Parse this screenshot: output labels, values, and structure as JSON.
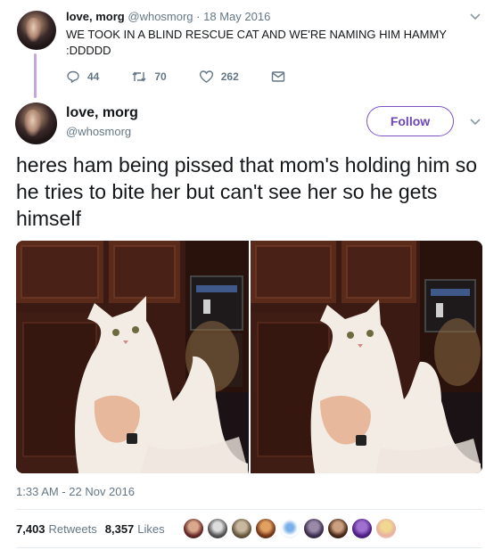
{
  "quoted_tweet": {
    "display_name": "love, morg",
    "handle": "@whosmorg",
    "separator": "·",
    "date": "18 May 2016",
    "text": "WE TOOK IN A BLIND RESCUE CAT AND WE'RE NAMING HIM HAMMY :DDDDD",
    "replies": "44",
    "retweets": "70",
    "likes": "262"
  },
  "tweet": {
    "display_name": "love, morg",
    "handle": "@whosmorg",
    "follow_label": "Follow",
    "text": "heres ham being pissed that mom's holding him so he tries to bite her but can't see her so he gets himself",
    "timestamp": "1:33 AM - 22 Nov 2016",
    "retweets_count": "7,403",
    "retweets_label": "Retweets",
    "likes_count": "8,357",
    "likes_label": "Likes"
  },
  "icons": {
    "reply": "reply-icon",
    "retweet": "retweet-icon",
    "like": "heart-icon",
    "dm": "envelope-icon",
    "caret": "chevron-down-icon"
  },
  "colors": {
    "follow_accent": "#6c46b8",
    "thread_line": "#c7a4e0",
    "meta_gray": "#657786"
  }
}
